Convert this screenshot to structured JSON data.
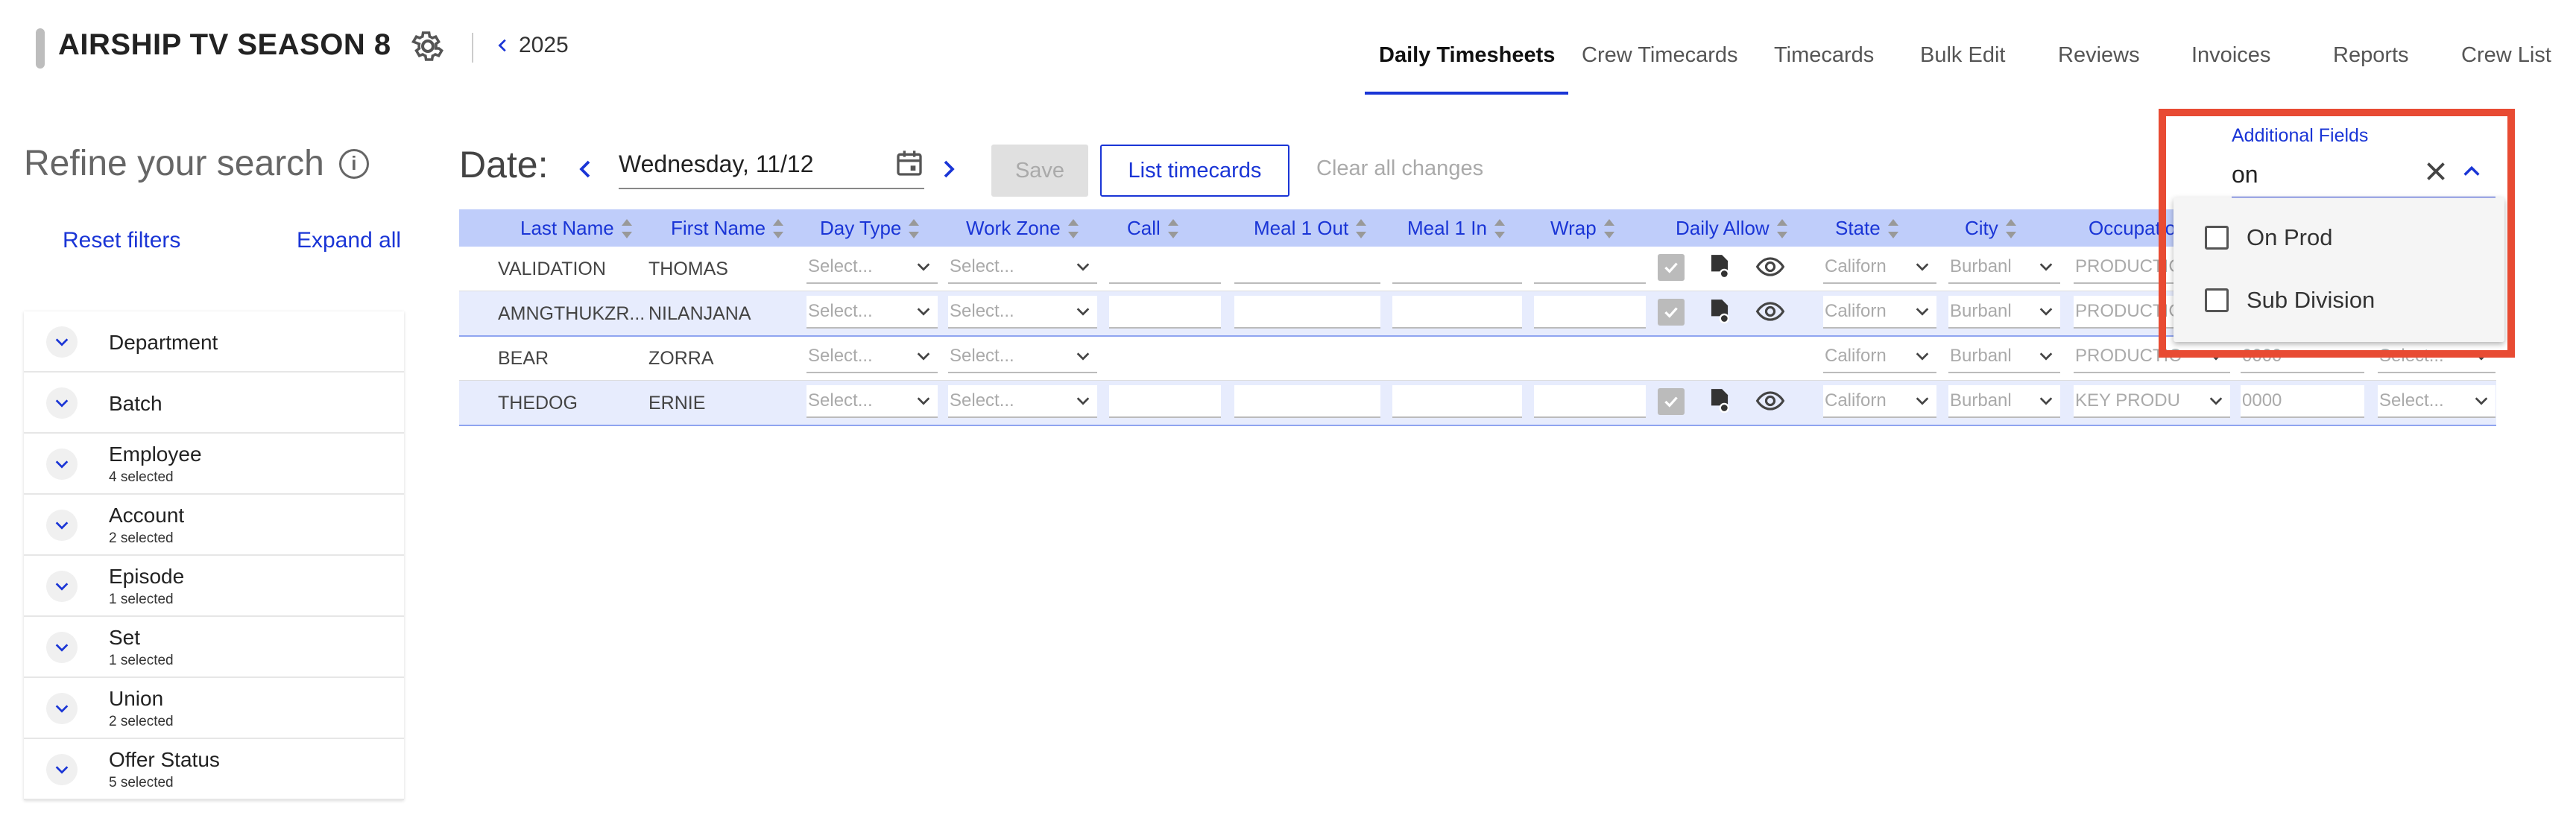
{
  "app": {
    "title": "AIRSHIP TV SEASON 8",
    "back_label": "2025"
  },
  "nav": [
    "Daily Timesheets",
    "Crew Timecards",
    "Timecards",
    "Bulk Edit",
    "Reviews",
    "Invoices",
    "Reports",
    "Crew List"
  ],
  "nav_active": "Daily Timesheets",
  "sidebar": {
    "heading": "Refine your search",
    "reset_label": "Reset filters",
    "expand_label": "Expand all",
    "filters": [
      {
        "name": "Department",
        "sub": ""
      },
      {
        "name": "Batch",
        "sub": ""
      },
      {
        "name": "Employee",
        "sub": "4 selected"
      },
      {
        "name": "Account",
        "sub": "2 selected"
      },
      {
        "name": "Episode",
        "sub": "1 selected"
      },
      {
        "name": "Set",
        "sub": "1 selected"
      },
      {
        "name": "Union",
        "sub": "2 selected"
      },
      {
        "name": "Offer Status",
        "sub": "5 selected"
      }
    ]
  },
  "toolbar": {
    "date_label": "Date:",
    "date_value": "Wednesday, 11/12",
    "save_label": "Save",
    "list_label": "List timecards",
    "clear_label": "Clear all changes"
  },
  "table": {
    "columns": [
      "Last Name",
      "First Name",
      "Day Type",
      "Work Zone",
      "Call",
      "Meal 1 Out",
      "Meal 1 In",
      "Wrap",
      "Daily Allow",
      "State",
      "City",
      "Occupatio"
    ],
    "select_placeholder": "Select...",
    "rows": [
      {
        "last": "VALIDATION",
        "first": "THOMAS",
        "state": "Californ",
        "city": "Burbanl",
        "occupation": "PRODUCTIC",
        "code": "",
        "extra": "",
        "has_allow": true
      },
      {
        "last": "AMNGTHUKZR...",
        "first": "NILANJANA",
        "state": "Californ",
        "city": "Burbanl",
        "occupation": "PRODUCTIC",
        "code": "",
        "extra": "",
        "has_allow": true
      },
      {
        "last": "BEAR",
        "first": "ZORRA",
        "state": "Californ",
        "city": "Burbanl",
        "occupation": "PRODUCTIC",
        "code": "0000",
        "extra": "Select...",
        "has_allow": false
      },
      {
        "last": "THEDOG",
        "first": "ERNIE",
        "state": "Californ",
        "city": "Burbanl",
        "occupation": "KEY PRODU",
        "code": "0000",
        "extra": "Select...",
        "has_allow": true
      }
    ]
  },
  "additional_fields": {
    "label": "Additional Fields",
    "query": "on",
    "options": [
      "On Prod",
      "Sub Division"
    ]
  },
  "colors": {
    "accent": "#1a35d6",
    "header_bg": "#bfcdfa",
    "highlight": "#e84b33"
  }
}
